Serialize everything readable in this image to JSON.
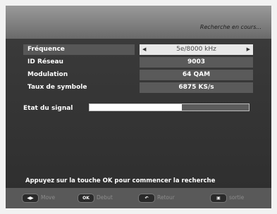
{
  "header": {
    "title": "Recherche en cours..."
  },
  "settings": [
    {
      "label": "Fréquence",
      "value": "5e/8000 kHz",
      "selected": true
    },
    {
      "label": "ID Réseau",
      "value": "9003",
      "selected": false
    },
    {
      "label": "Modulation",
      "value": "64 QAM",
      "selected": false
    },
    {
      "label": "Taux de symbole",
      "value": "6875 KS/s",
      "selected": false
    }
  ],
  "signal": {
    "label": "Etat du signal",
    "level_percent": 58
  },
  "hint": "Appuyez sur la touche OK pour commencer la recherche",
  "footer": [
    {
      "key": "◀▶",
      "label": "Move",
      "icon": "nav-arrows-icon"
    },
    {
      "key": "OK",
      "label": "Debut",
      "icon": "ok-key-icon"
    },
    {
      "key": "↶",
      "label": "Retour",
      "icon": "return-key-icon"
    },
    {
      "key": "▣",
      "label": "sortie",
      "icon": "exit-key-icon"
    }
  ],
  "colors": {
    "panel": "#333333",
    "header": "#8a8a8a",
    "selected_value_bg": "#e8e8e8",
    "footer": "#595959"
  }
}
